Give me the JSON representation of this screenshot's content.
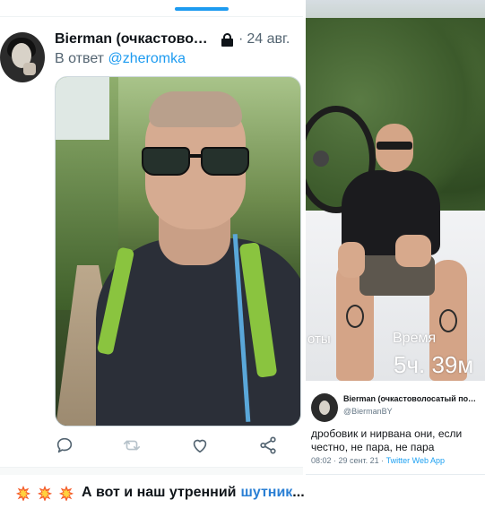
{
  "left_tweet": {
    "display_name": "Bierman (очкастовол…",
    "date": "24 авг.",
    "dot_separator": "·",
    "reply_prefix": "В ответ",
    "reply_handle": "@zheromka"
  },
  "right_photo": {
    "overlay_left": "оты",
    "overlay_label": "Время",
    "overlay_value": "5ч. 39м"
  },
  "mini_tweet": {
    "display_name": "Bierman (очкастовол­осатый под...",
    "handle": "@BiermanBY",
    "text": "дробовик и нирвана они, если честно, не пара, не пара",
    "time": "08:02 · 29 сент. 21 ·",
    "source": "Twitter Web App"
  },
  "caption": {
    "text": "А вот и наш утренний",
    "link": "шутник",
    "suffix": "..."
  },
  "colors": {
    "accent_blue": "#1d9bf0",
    "caption_link": "#2a7fd4"
  }
}
